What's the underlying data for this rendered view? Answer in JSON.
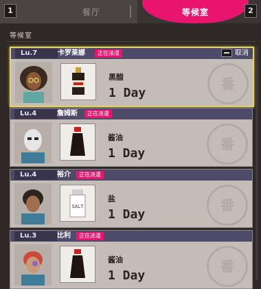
{
  "tabs": {
    "left_key": "1",
    "left_label": "餐厅",
    "right_label": "等候室",
    "right_key": "2"
  },
  "section": {
    "title": "等候室"
  },
  "cards": [
    {
      "level": "Lu.7",
      "name": "卡罗莱娜",
      "status": "正在派遣",
      "cancel_label": "取消",
      "item_icon": "vinegar-bottle-icon",
      "item_name": "黑醋",
      "duration": "1 Day",
      "active": true
    },
    {
      "level": "Lu.4",
      "name": "詹姆斯",
      "status": "正在派遣",
      "item_icon": "soy-sauce-bottle-icon",
      "item_name": "酱油",
      "duration": "1 Day",
      "active": false
    },
    {
      "level": "Lu.4",
      "name": "裕介",
      "status": "正在派遣",
      "item_icon": "salt-shaker-icon",
      "item_name": "盐",
      "duration": "1 Day",
      "active": false
    },
    {
      "level": "Lu.3",
      "name": "比利",
      "status": "正在派遣",
      "item_icon": "soy-sauce-bottle-icon",
      "item_name": "酱油",
      "duration": "1 Day",
      "active": false
    }
  ],
  "colors": {
    "accent": "#e8146e",
    "header": "#4e4a6a",
    "card_bg": "#c4bcb6",
    "highlight": "#e6d36a"
  }
}
